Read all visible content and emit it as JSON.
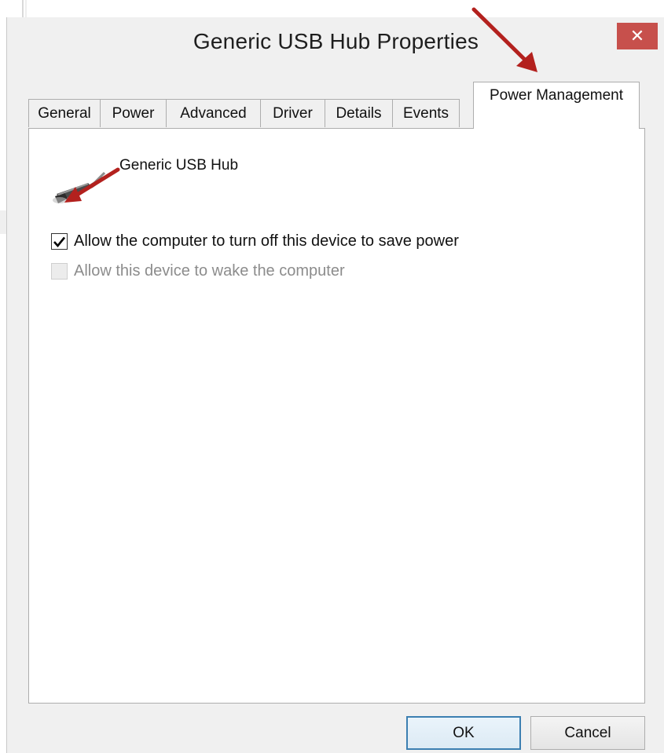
{
  "window": {
    "title": "Generic USB Hub Properties",
    "close_icon": "close-icon",
    "close_glyph": "✕",
    "close_color": "#c7504c"
  },
  "tabs": [
    {
      "label": "General"
    },
    {
      "label": "Power"
    },
    {
      "label": "Advanced"
    },
    {
      "label": "Driver"
    },
    {
      "label": "Details"
    },
    {
      "label": "Events"
    },
    {
      "label": "Power Management",
      "active": true
    }
  ],
  "panel": {
    "device_icon": "usb-plug-icon",
    "device_name": "Generic USB Hub",
    "options": [
      {
        "label": "Allow the computer to turn off this device to save power",
        "checked": true,
        "enabled": true
      },
      {
        "label": "Allow this device to wake the computer",
        "checked": false,
        "enabled": false
      }
    ]
  },
  "buttons": {
    "ok": "OK",
    "cancel": "Cancel"
  },
  "annotations": {
    "arrow_color": "#b3211e",
    "arrows": [
      "points-to-power-management-tab",
      "points-to-allow-turn-off-checkbox"
    ]
  }
}
